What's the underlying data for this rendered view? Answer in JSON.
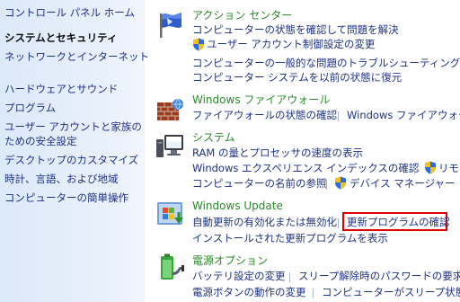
{
  "nav": {
    "home": "コントロール パネル ホーム",
    "current": "システムとセキュリティ",
    "items": [
      "ネットワークとインターネット",
      "ハードウェアとサウンド",
      "プログラム",
      "ユーザー アカウントと家族の",
      "ための安全設定",
      "デスクトップのカスタマイズ",
      "時計、言語、および地域",
      "コンピューターの簡単操作"
    ]
  },
  "categories": {
    "action_center": {
      "title": "アクション センター",
      "icon": "flag-icon",
      "tasks": [
        "コンピューターの状態を確認して問題を解決",
        "ユーザー アカウント制御設定の変更",
        "コンピューターの一般的な問題のトラブルシューティング",
        "コンピューター システムを以前の状態に復元"
      ]
    },
    "firewall": {
      "title": "Windows ファイアウォール",
      "icon": "firewall-icon",
      "tasks": [
        "ファイアウォールの状態の確認",
        "Windows ファイアウォー"
      ]
    },
    "system": {
      "title": "システム",
      "icon": "computer-icon",
      "tasks": [
        "RAM の量とプロセッサの速度の表示",
        "Windows エクスペリエンス インデックスの確認",
        "リモー",
        "コンピューターの名前の参照",
        "デバイス マネージャー"
      ]
    },
    "windows_update": {
      "title": "Windows Update",
      "icon": "windows-update-icon",
      "tasks": [
        "自動更新の有効化または無効化",
        "更新プログラムの確認",
        "インストールされた更新プログラムを表示"
      ]
    },
    "power": {
      "title": "電源オプション",
      "icon": "power-options-icon",
      "tasks": [
        "バッテリ設定の変更",
        "スリープ解除時のパスワードの要求",
        "電源ボタンの動作の変更",
        "コンピューターがスリープ状態"
      ]
    }
  },
  "colors": {
    "link": "#1e3287",
    "category_title": "#2a8a2a",
    "highlight": "#e00000",
    "nav_background": "#dce9f9"
  }
}
